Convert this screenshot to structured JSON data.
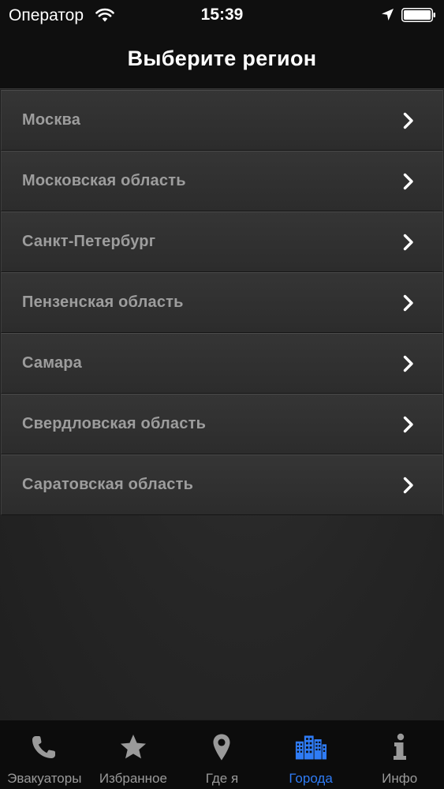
{
  "status_bar": {
    "carrier": "Оператор",
    "time": "15:39",
    "icons": [
      "wifi-icon",
      "location-arrow-icon",
      "battery-icon"
    ]
  },
  "nav": {
    "title": "Выберите регион"
  },
  "regions": [
    {
      "label": "Москва",
      "icon": "chevron-right-icon"
    },
    {
      "label": "Московская область",
      "icon": "chevron-right-icon"
    },
    {
      "label": "Санкт-Петербург",
      "icon": "chevron-right-icon"
    },
    {
      "label": "Пензенская область",
      "icon": "chevron-right-icon"
    },
    {
      "label": "Самара",
      "icon": "chevron-right-icon"
    },
    {
      "label": "Свердловская область",
      "icon": "chevron-right-icon"
    },
    {
      "label": "Саратовская область",
      "icon": "chevron-right-icon"
    }
  ],
  "tabs": [
    {
      "label": "Эвакуаторы",
      "icon": "phone-icon",
      "active": false
    },
    {
      "label": "Избранное",
      "icon": "star-icon",
      "active": false
    },
    {
      "label": "Где я",
      "icon": "map-pin-icon",
      "active": false
    },
    {
      "label": "Города",
      "icon": "city-buildings-icon",
      "active": true
    },
    {
      "label": "Инфо",
      "icon": "info-icon",
      "active": false
    }
  ],
  "colors": {
    "accent": "#2f7cf6",
    "tab_inactive": "#9a9a9a",
    "list_text": "#9d9d9d",
    "background": "#262626"
  }
}
